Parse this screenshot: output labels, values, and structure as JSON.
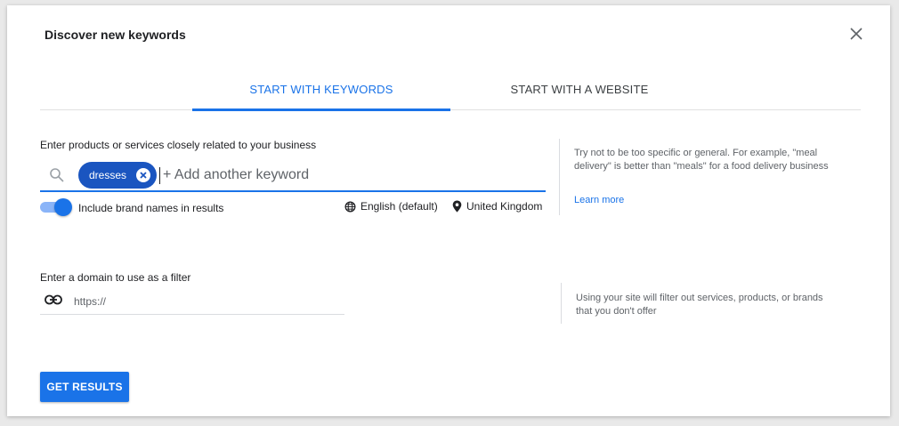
{
  "dialog": {
    "title": "Discover new keywords",
    "close_icon": "close-icon"
  },
  "tabs": [
    {
      "label": "START WITH KEYWORDS",
      "active": true
    },
    {
      "label": "START WITH A WEBSITE",
      "active": false
    }
  ],
  "keywords": {
    "section_label": "Enter products or services closely related to your business",
    "chips": [
      {
        "label": "dresses"
      }
    ],
    "placeholder": "+ Add another keyword",
    "include_brand_names": {
      "label": "Include brand names in results",
      "enabled": true
    },
    "language": "English (default)",
    "location": "United Kingdom",
    "hint": "Try not to be too specific or general. For example, \"meal delivery\" is better than \"meals\" for a food delivery business",
    "learn_more": "Learn more"
  },
  "domain_filter": {
    "section_label": "Enter a domain to use as a filter",
    "placeholder": "https://",
    "hint": "Using your site will filter out services, products, or brands that you don't offer"
  },
  "actions": {
    "get_results": "GET RESULTS"
  },
  "colors": {
    "accent": "#1a73e8",
    "chip": "#1a55c0",
    "toggle_track": "#8ab4f8"
  }
}
